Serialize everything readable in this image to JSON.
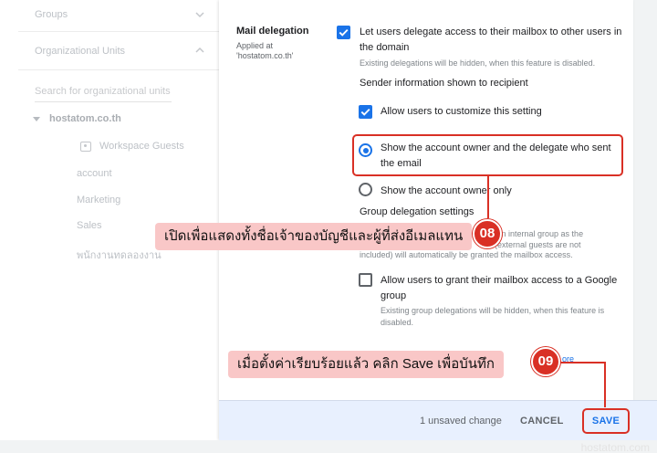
{
  "sidebar": {
    "groups_label": "Groups",
    "ou_label": "Organizational Units",
    "search_placeholder": "Search for organizational units",
    "root_ou": "hostatom.co.th",
    "children": [
      "Workspace Guests",
      "account",
      "Marketing",
      "Sales",
      "พนักงานทดลองงาน"
    ]
  },
  "setting": {
    "name": "Mail delegation",
    "applied_line1": "Applied at",
    "applied_line2": "'hostatom.co.th'",
    "delegate_label_l1": "Let users delegate access to their mailbox to other users in",
    "delegate_label_l2": "the domain",
    "delegate_hint": "Existing delegations will be hidden, when this feature is disabled.",
    "sender_info_heading": "Sender information shown to recipient",
    "customize_label": "Allow users to customize this setting",
    "radio_owner_delegate_l1": "Show the account owner and the delegate who sent",
    "radio_owner_delegate_l2": "the email",
    "radio_owner_only": "Show the account owner only",
    "group_delegation_heading": "Group delegation settings",
    "group_hint_l1": "d an internal group as the",
    "group_hint_l2": ". (external guests are not",
    "group_hint_l3": "included) will automatically be granted the mailbox access.",
    "google_group_label_l1": "Allow users to grant their mailbox access to a Google",
    "google_group_label_l2": "group",
    "google_group_hint_l1": "Existing group delegations will be hidden, when this feature is",
    "google_group_hint_l2": "disabled.",
    "learn_more_fragment": "ore"
  },
  "footer": {
    "unsaved": "1 unsaved change",
    "cancel": "CANCEL",
    "save": "SAVE"
  },
  "annotations": {
    "step08_text": "เปิดเพื่อแสดงทั้งชื่อเจ้าของบัญชีและผู้ที่ส่งอีเมลแทน",
    "step08_num": "08",
    "step09_text": "เมื่อตั้งค่าเรียบร้อยแล้ว คลิก Save เพื่อบันทึก",
    "step09_num": "09"
  },
  "watermark": "hostatom.com",
  "colors": {
    "accent": "#1a73e8",
    "annotation": "#d93025",
    "callout_bg": "#f9c7c7"
  }
}
